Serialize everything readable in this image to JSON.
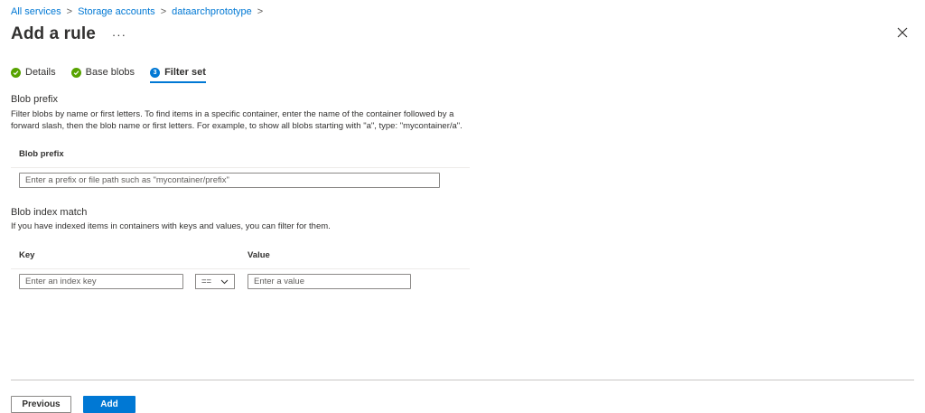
{
  "breadcrumb": {
    "items": [
      "All services",
      "Storage accounts",
      "dataarchprototype"
    ],
    "separator": ">"
  },
  "header": {
    "title": "Add a rule",
    "more": "···",
    "close_icon": "close-icon"
  },
  "tabs": [
    {
      "label": "Details",
      "badge": "",
      "state": "done"
    },
    {
      "label": "Base blobs",
      "badge": "",
      "state": "done"
    },
    {
      "label": "Filter set",
      "badge": "3",
      "state": "active"
    }
  ],
  "blob_prefix": {
    "section_label": "Blob prefix",
    "description": "Filter blobs by name or first letters. To find items in a specific container, enter the name of the container followed by a forward slash, then the blob name or first letters. For example, to show all blobs starting with \"a\", type: \"mycontainer/a\".",
    "column_header": "Blob prefix",
    "input_value": "",
    "input_placeholder": "Enter a prefix or file path such as \"mycontainer/prefix\""
  },
  "blob_index": {
    "section_label": "Blob index match",
    "description": "If you have indexed items in containers with keys and values, you can filter for them.",
    "key_header": "Key",
    "value_header": "Value",
    "key_placeholder": "Enter an index key",
    "operator_value": "==",
    "value_placeholder": "Enter a value"
  },
  "footer": {
    "previous_label": "Previous",
    "add_label": "Add"
  },
  "colors": {
    "accent": "#0078d4",
    "success": "#57a300"
  }
}
